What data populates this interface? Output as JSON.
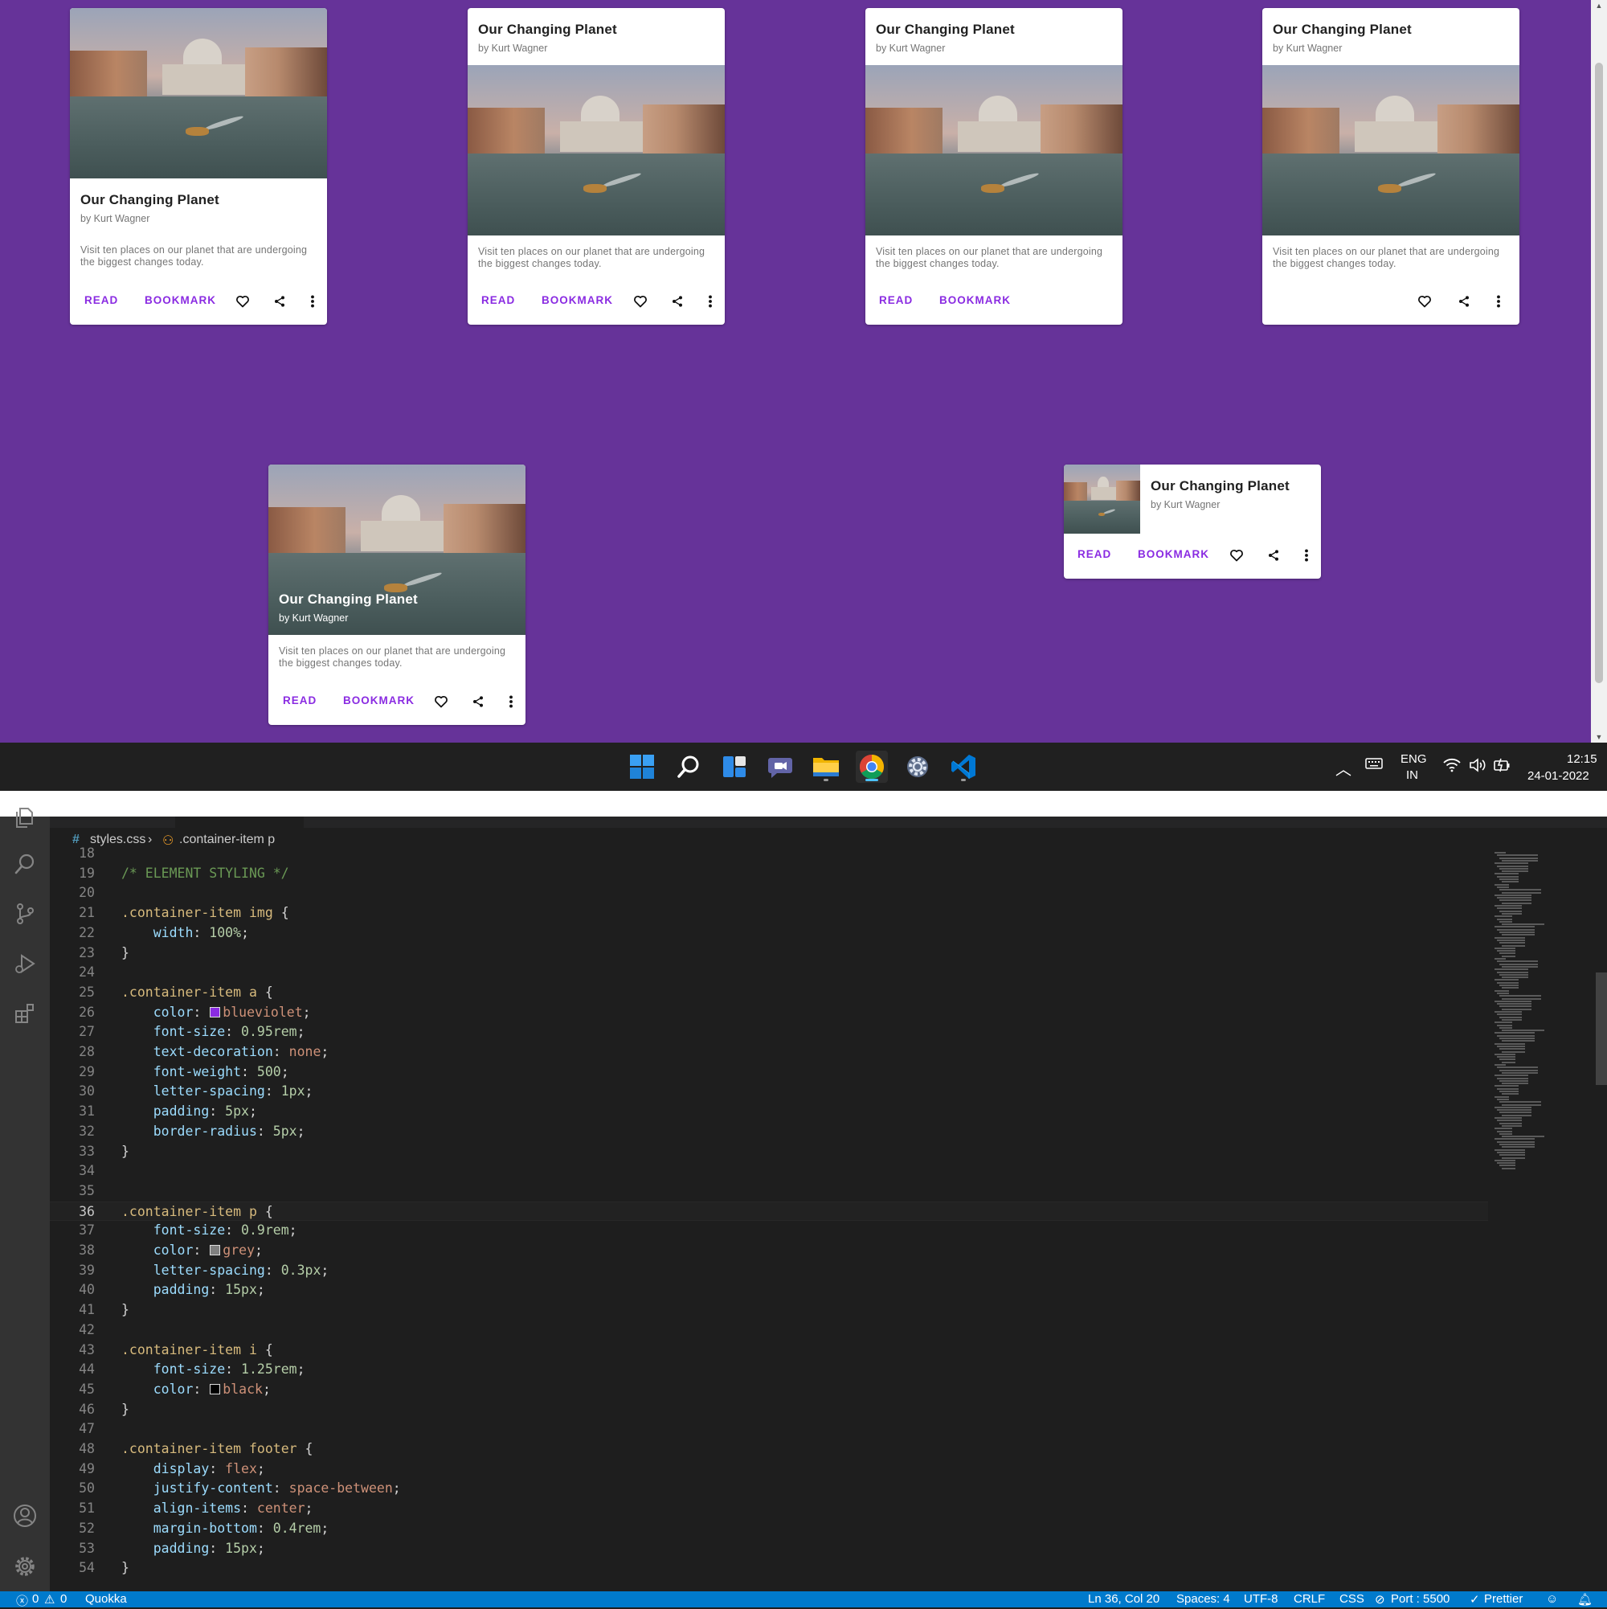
{
  "cards": [
    {
      "title": "Our Changing Planet",
      "author": "by Kurt Wagner",
      "description": "Visit ten places on our planet that are undergoing the biggest changes today.",
      "read": "READ",
      "bookmark": "BOOKMARK"
    },
    {
      "title": "Our Changing Planet",
      "author": "by Kurt Wagner",
      "description": "Visit ten places on our planet that are undergoing the biggest changes today.",
      "read": "READ",
      "bookmark": "BOOKMARK"
    },
    {
      "title": "Our Changing Planet",
      "author": "by Kurt Wagner",
      "description": "Visit ten places on our planet that are undergoing the biggest changes today.",
      "read": "READ",
      "bookmark": "BOOKMARK"
    },
    {
      "title": "Our Changing Planet",
      "author": "by Kurt Wagner",
      "description": "Visit ten places on our planet that are undergoing the biggest changes today."
    },
    {
      "title": "Our Changing Planet",
      "author": "by Kurt Wagner",
      "description": "Visit ten places on our planet that are undergoing the biggest changes today.",
      "read": "READ",
      "bookmark": "BOOKMARK"
    },
    {
      "title": "Our Changing Planet",
      "author": "by Kurt Wagner",
      "read": "READ",
      "bookmark": "BOOKMARK"
    }
  ],
  "colors": {
    "page_bg": "#663399",
    "accent": "#8a2be2",
    "statusbar": "#007acc",
    "editor_bg": "#1e1e1e"
  },
  "taskbar": {
    "apps": [
      "windows-start",
      "search",
      "widgets",
      "teams-chat",
      "file-explorer",
      "chrome",
      "settings",
      "vscode"
    ],
    "lang_top": "ENG",
    "lang_bottom": "IN",
    "time": "12:15",
    "date": "24-01-2022"
  },
  "editor": {
    "breadcrumb_file": "styles.css",
    "breadcrumb_symbol": ".container-item p",
    "lines": [
      {
        "n": "18"
      },
      {
        "n": "19",
        "t": "/* ELEMENT STYLING */"
      },
      {
        "n": "20"
      },
      {
        "n": "21",
        "t": ".container-item img {"
      },
      {
        "n": "22",
        "t": "    width: 100%;"
      },
      {
        "n": "23",
        "t": "}"
      },
      {
        "n": "24"
      },
      {
        "n": "25",
        "t": ".container-item a {"
      },
      {
        "n": "26",
        "t": "    color: blueviolet;"
      },
      {
        "n": "27",
        "t": "    font-size: 0.95rem;"
      },
      {
        "n": "28",
        "t": "    text-decoration: none;"
      },
      {
        "n": "29",
        "t": "    font-weight: 500;"
      },
      {
        "n": "30",
        "t": "    letter-spacing: 1px;"
      },
      {
        "n": "31",
        "t": "    padding: 5px;"
      },
      {
        "n": "32",
        "t": "    border-radius: 5px;"
      },
      {
        "n": "33",
        "t": "}"
      },
      {
        "n": "34"
      },
      {
        "n": "35"
      },
      {
        "n": "36",
        "t": ".container-item p {"
      },
      {
        "n": "37",
        "t": "    font-size: 0.9rem;"
      },
      {
        "n": "38",
        "t": "    color: grey;"
      },
      {
        "n": "39",
        "t": "    letter-spacing: 0.3px;"
      },
      {
        "n": "40",
        "t": "    padding: 15px;"
      },
      {
        "n": "41",
        "t": "}"
      },
      {
        "n": "42"
      },
      {
        "n": "43",
        "t": ".container-item i {"
      },
      {
        "n": "44",
        "t": "    font-size: 1.25rem;"
      },
      {
        "n": "45",
        "t": "    color: black;"
      },
      {
        "n": "46",
        "t": "}"
      },
      {
        "n": "47"
      },
      {
        "n": "48",
        "t": ".container-item footer {"
      },
      {
        "n": "49",
        "t": "    display: flex;"
      },
      {
        "n": "50",
        "t": "    justify-content: space-between;"
      },
      {
        "n": "51",
        "t": "    align-items: center;"
      },
      {
        "n": "52",
        "t": "    margin-bottom: 0.4rem;"
      },
      {
        "n": "53",
        "t": "    padding: 15px;"
      },
      {
        "n": "54",
        "t": "}"
      }
    ],
    "current_line": "36"
  },
  "statusbar": {
    "errors": "0",
    "warnings": "0",
    "quokka": "Quokka",
    "position": "Ln 36, Col 20",
    "spaces": "Spaces: 4",
    "encoding": "UTF-8",
    "eol": "CRLF",
    "language": "CSS",
    "port": "Port : 5500",
    "prettier": "Prettier"
  }
}
